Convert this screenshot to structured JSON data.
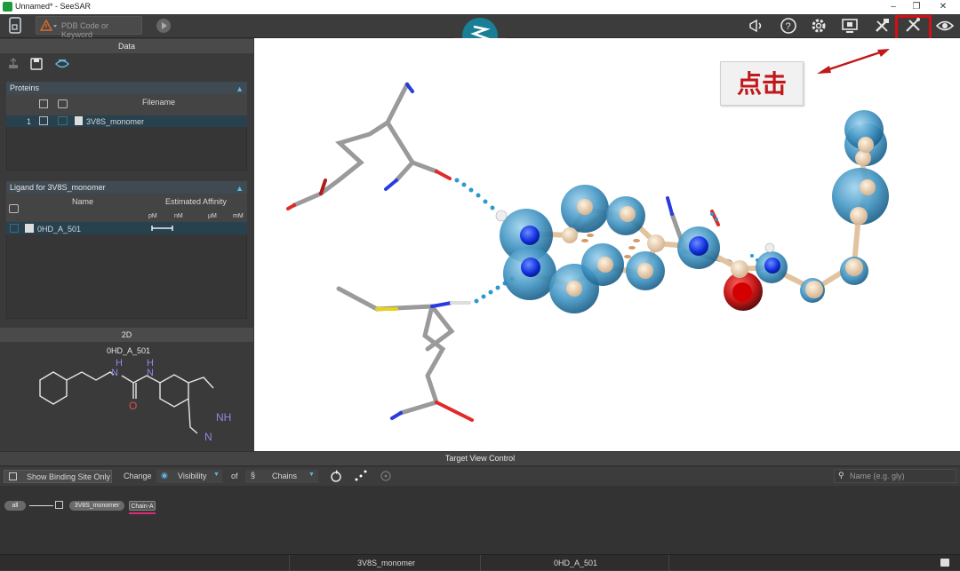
{
  "window": {
    "title": "Unnamed* - SeeSAR",
    "controls": [
      "–",
      "❐",
      "✕"
    ]
  },
  "toolbar": {
    "search_placeholder": "PDB Code or Keyword"
  },
  "data_panel": {
    "title": "Data",
    "proteins": {
      "label": "Proteins",
      "column_filename": "Filename",
      "rows": [
        {
          "index": "1",
          "filename": "3V8S_monomer"
        }
      ]
    },
    "ligand": {
      "label": "Ligand for 3V8S_monomer",
      "col_name": "Name",
      "col_affinity": "Estimated Affinity",
      "units": [
        "pM",
        "nM",
        "µM",
        "mM"
      ],
      "rows": [
        {
          "name": "0HD_A_501"
        }
      ]
    }
  },
  "panel_2d": {
    "title": "2D",
    "ligand_name": "0HD_A_501",
    "atoms": {
      "nh_top": "H",
      "n_top": "N",
      "n_top2": "N",
      "h_top2": "H",
      "o": "O",
      "nh_right": "NH",
      "n_bottom": "N"
    }
  },
  "callout": {
    "text": "点击"
  },
  "target_view": {
    "title": "Target View Control",
    "show_binding_site_only": "Show Binding Site Only",
    "change": "Change",
    "visibility": "Visibility",
    "of": "of",
    "chains": "Chains",
    "name_search_placeholder": "Name (e.g. gly)",
    "tree": {
      "all": "all",
      "protein": "3V8S_monomer",
      "chain": "Chain-A"
    }
  },
  "status_bar": {
    "protein": "3V8S_monomer",
    "ligand": "0HD_A_501"
  },
  "colors": {
    "accent": "#cc1f1f",
    "highlight_pink": "#e0287a",
    "selection": "#27414e",
    "logo_teal": "#1a7f95"
  }
}
